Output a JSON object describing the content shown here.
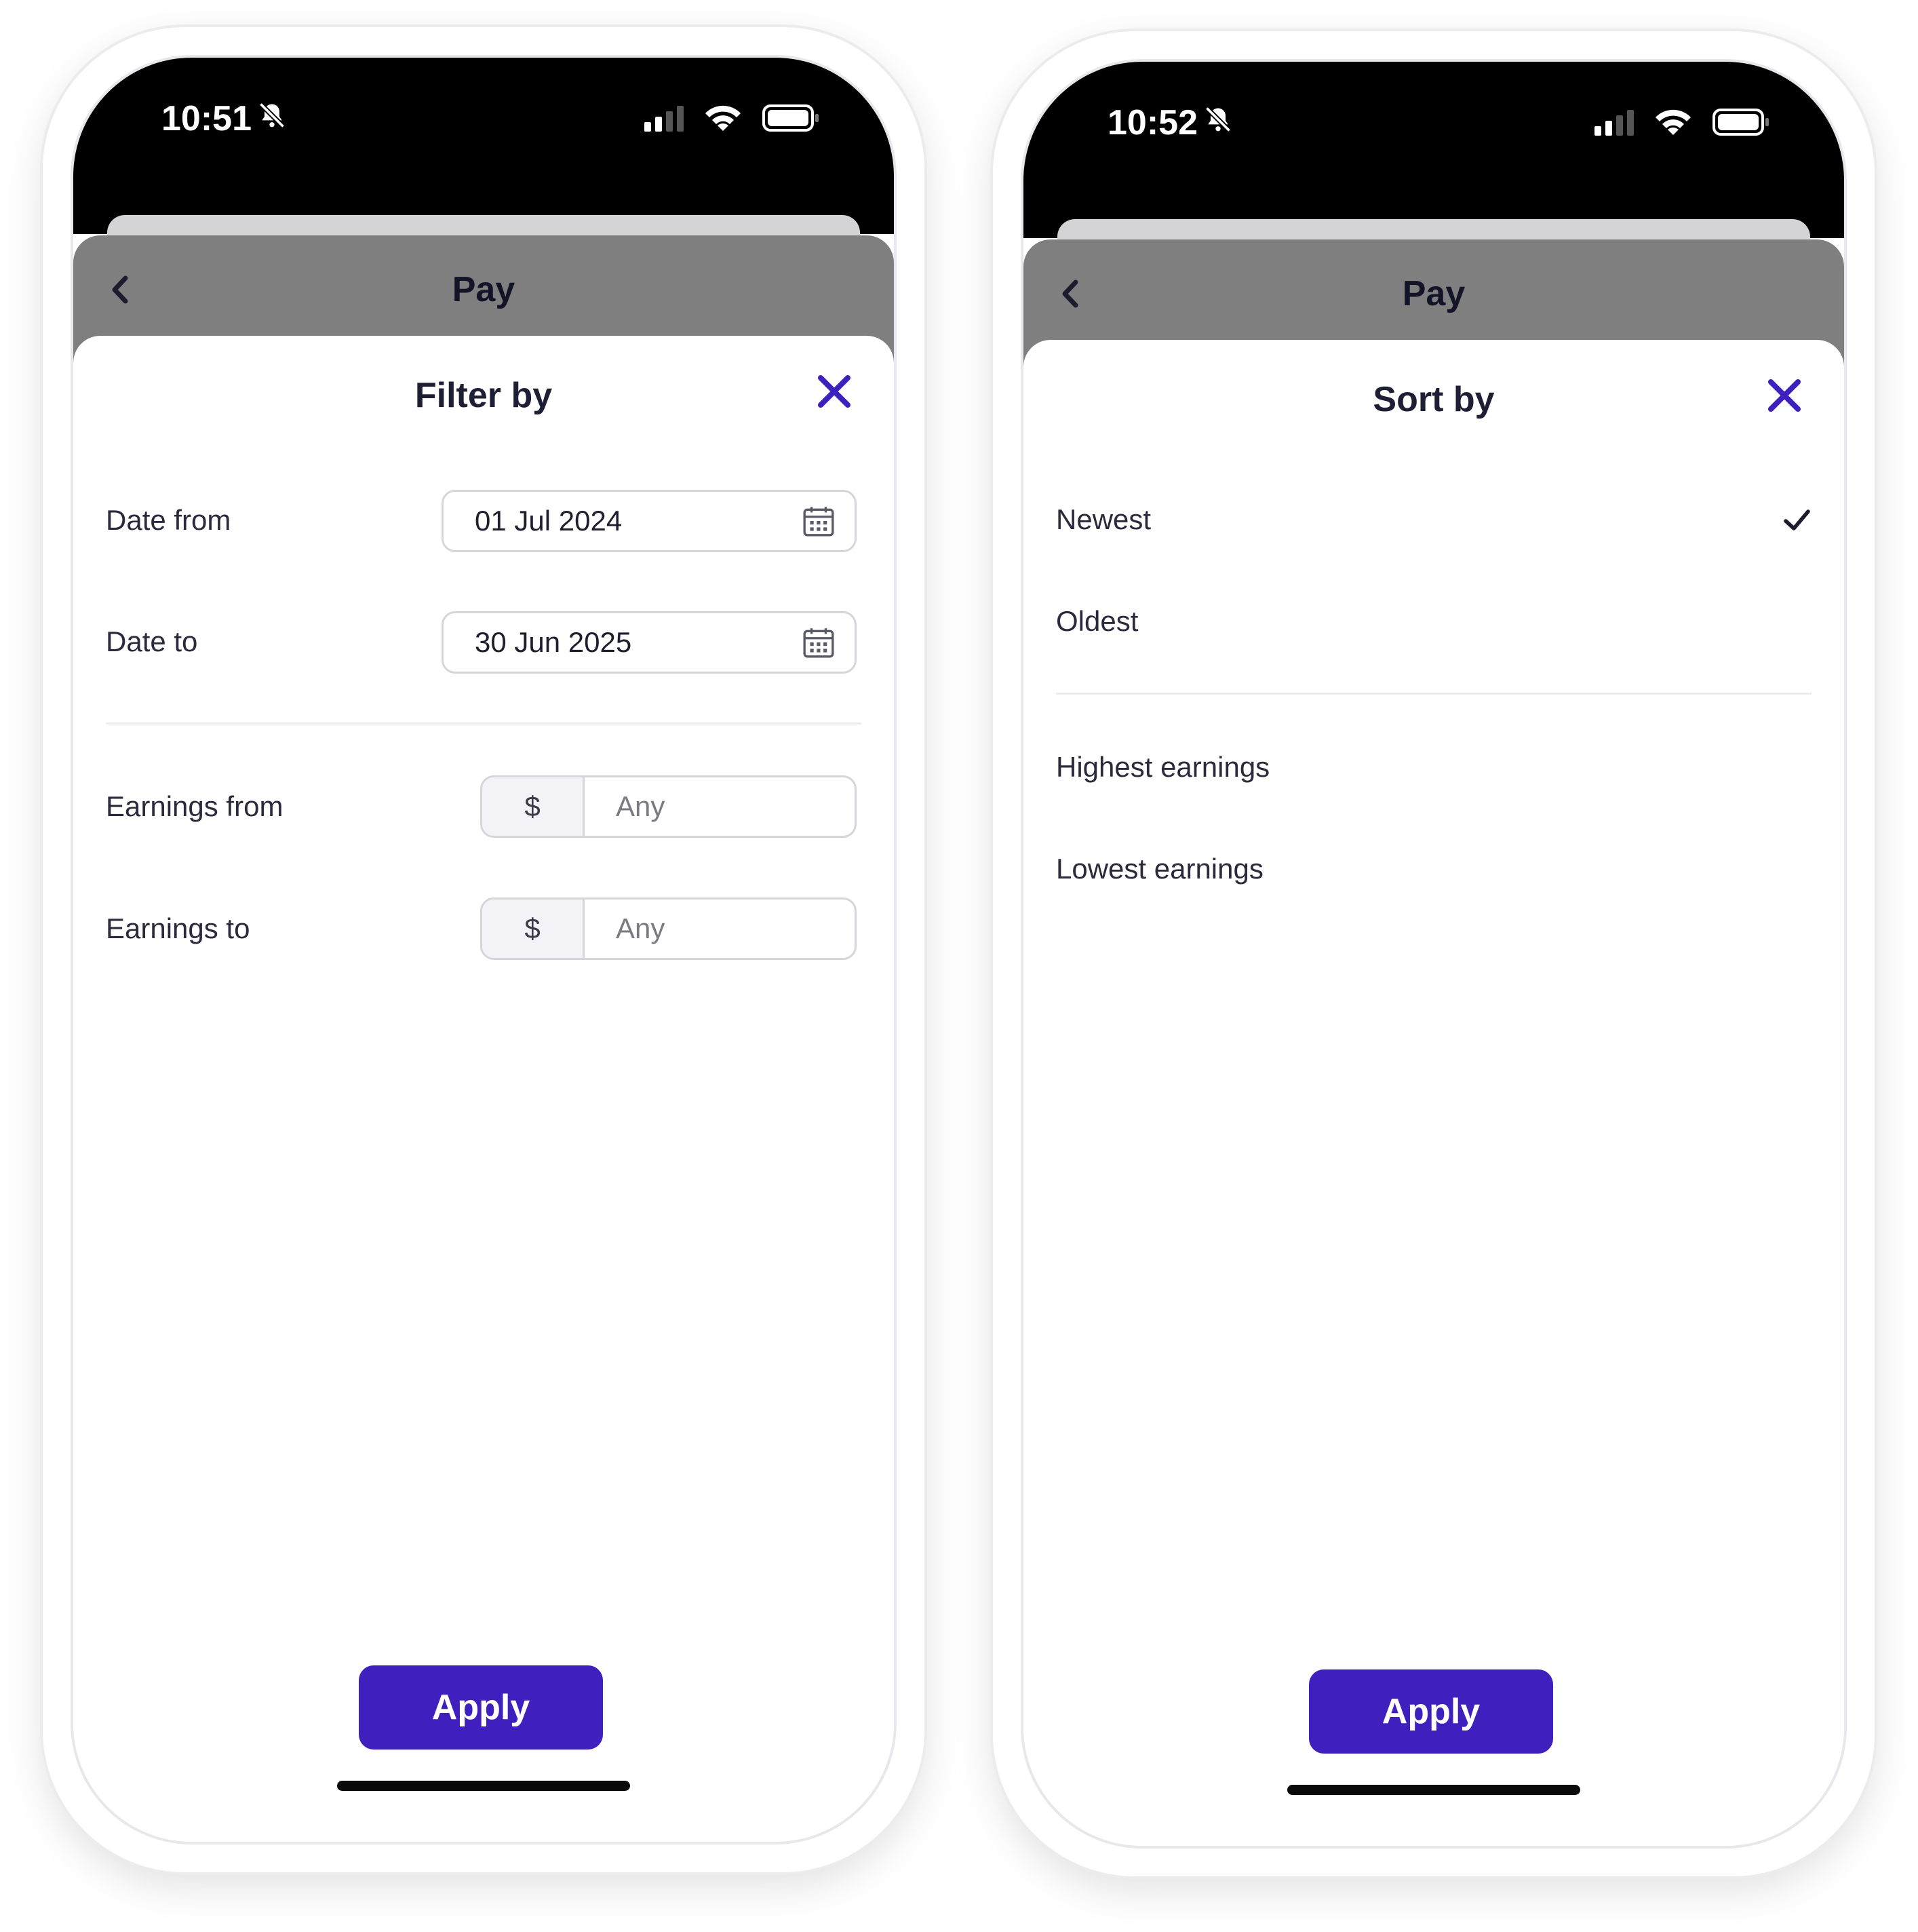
{
  "accent_color": "#3f1fbe",
  "left_screen": {
    "status": {
      "time": "10:51"
    },
    "nav": {
      "title": "Pay"
    },
    "modal": {
      "title": "Filter by",
      "date_from": {
        "label": "Date from",
        "value": "01 Jul 2024"
      },
      "date_to": {
        "label": "Date to",
        "value": "30 Jun 2025"
      },
      "earnings_from": {
        "label": "Earnings from",
        "currency": "$",
        "placeholder": "Any"
      },
      "earnings_to": {
        "label": "Earnings to",
        "currency": "$",
        "placeholder": "Any"
      },
      "apply_label": "Apply"
    }
  },
  "right_screen": {
    "status": {
      "time": "10:52"
    },
    "nav": {
      "title": "Pay"
    },
    "modal": {
      "title": "Sort by",
      "options": [
        {
          "label": "Newest",
          "selected": true
        },
        {
          "label": "Oldest",
          "selected": false
        },
        {
          "label": "Highest earnings",
          "selected": false
        },
        {
          "label": "Lowest earnings",
          "selected": false
        }
      ],
      "apply_label": "Apply"
    }
  }
}
